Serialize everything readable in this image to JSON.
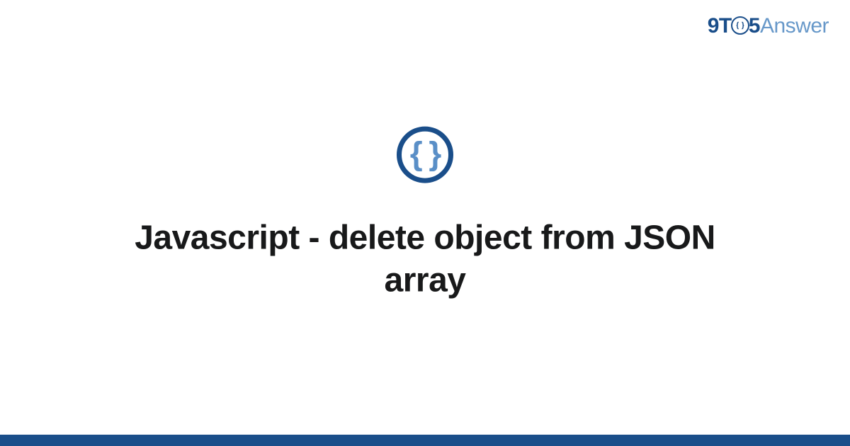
{
  "brand": {
    "part1": "9T",
    "part2": "5",
    "part3": "Answer"
  },
  "badge": {
    "symbol": "{ }",
    "name": "code-braces"
  },
  "title": "Javascript - delete object from JSON array",
  "colors": {
    "primary": "#1a4e8a",
    "accent": "#5a8fc7",
    "light": "#6798c9"
  }
}
